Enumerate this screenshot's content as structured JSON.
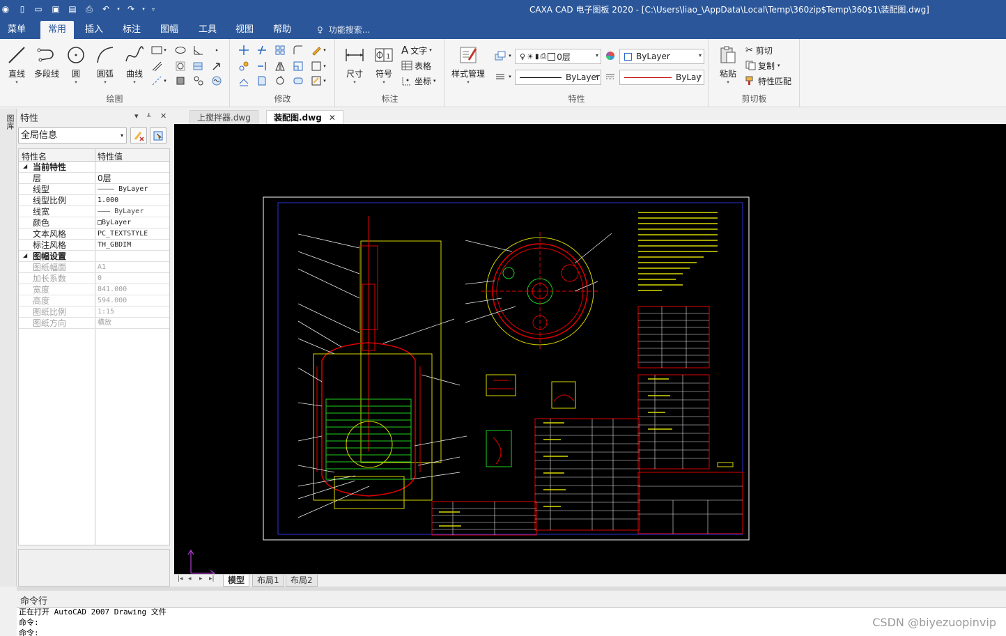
{
  "window": {
    "title": "CAXA CAD 电子图板 2020 - [C:\\Users\\liao_\\AppData\\Local\\Temp\\360zip$Temp\\360$1\\装配图.dwg]"
  },
  "ribbon_tabs": [
    "菜单",
    "常用",
    "插入",
    "标注",
    "图幅",
    "工具",
    "视图",
    "帮助"
  ],
  "ribbon_active_tab": "常用",
  "search_hint": "功能搜索...",
  "ribbon": {
    "draw": {
      "label": "绘图",
      "line": "直线",
      "polyline": "多段线",
      "circle": "圆",
      "arc": "圆弧",
      "curve": "曲线"
    },
    "modify": {
      "label": "修改"
    },
    "annotate": {
      "label": "标注",
      "dimension": "尺寸",
      "symbol": "符号",
      "text": "文字",
      "table": "表格",
      "coordinate": "坐标"
    },
    "properties": {
      "label": "特性",
      "style_manager": "样式管理",
      "layer_value": "0层",
      "color_value": "ByLayer",
      "linetype_value": "ByLayer",
      "lineweight_value": "ByLay",
      "colors": {
        "accent_red": "#c00000"
      }
    },
    "clipboard": {
      "label": "剪切板",
      "paste": "粘贴",
      "cut": "剪切",
      "copy": "复制",
      "match": "特性匹配"
    }
  },
  "left_strip": {
    "label": "图库"
  },
  "properties_panel": {
    "title": "特性",
    "pin": "▾",
    "pin2": "ᚆ",
    "close": "✕",
    "scope": "全局信息",
    "header_name": "特性名",
    "header_value": "特性值",
    "sections": [
      {
        "name": "当前特性",
        "rows": [
          {
            "name": "层",
            "value": "0层",
            "dim": false
          },
          {
            "name": "线型",
            "value": "———— ByLayer",
            "dim": false
          },
          {
            "name": "线型比例",
            "value": "1.000",
            "dim": false
          },
          {
            "name": "线宽",
            "value": "——— ByLayer",
            "dim": false
          },
          {
            "name": "颜色",
            "value": "□ByLayer",
            "dim": false
          },
          {
            "name": "文本风格",
            "value": "PC_TEXTSTYLE",
            "dim": false
          },
          {
            "name": "标注风格",
            "value": "TH_GBDIM",
            "dim": false
          }
        ]
      },
      {
        "name": "图幅设置",
        "rows": [
          {
            "name": "图纸幅面",
            "value": "A1",
            "dim": true
          },
          {
            "name": "加长系数",
            "value": "0",
            "dim": true
          },
          {
            "name": "宽度",
            "value": "841.000",
            "dim": true
          },
          {
            "name": "高度",
            "value": "594.000",
            "dim": true
          },
          {
            "name": "图纸比例",
            "value": "1:15",
            "dim": true
          },
          {
            "name": "图纸方向",
            "value": "横放",
            "dim": true
          }
        ]
      }
    ]
  },
  "doc_tabs": [
    {
      "label": "上搅拌器.dwg",
      "active": false
    },
    {
      "label": "装配图.dwg",
      "active": true
    }
  ],
  "doc_tab_close": "✕",
  "layout_tabs": [
    {
      "label": "模型",
      "active": true
    },
    {
      "label": "布局1",
      "active": false
    },
    {
      "label": "布局2",
      "active": false
    }
  ],
  "command": {
    "title": "命令行",
    "lines": [
      "正在打开 AutoCAD 2007 Drawing 文件",
      "命令:",
      "命令:"
    ]
  },
  "watermark": "CSDN @biyezuopinvip"
}
